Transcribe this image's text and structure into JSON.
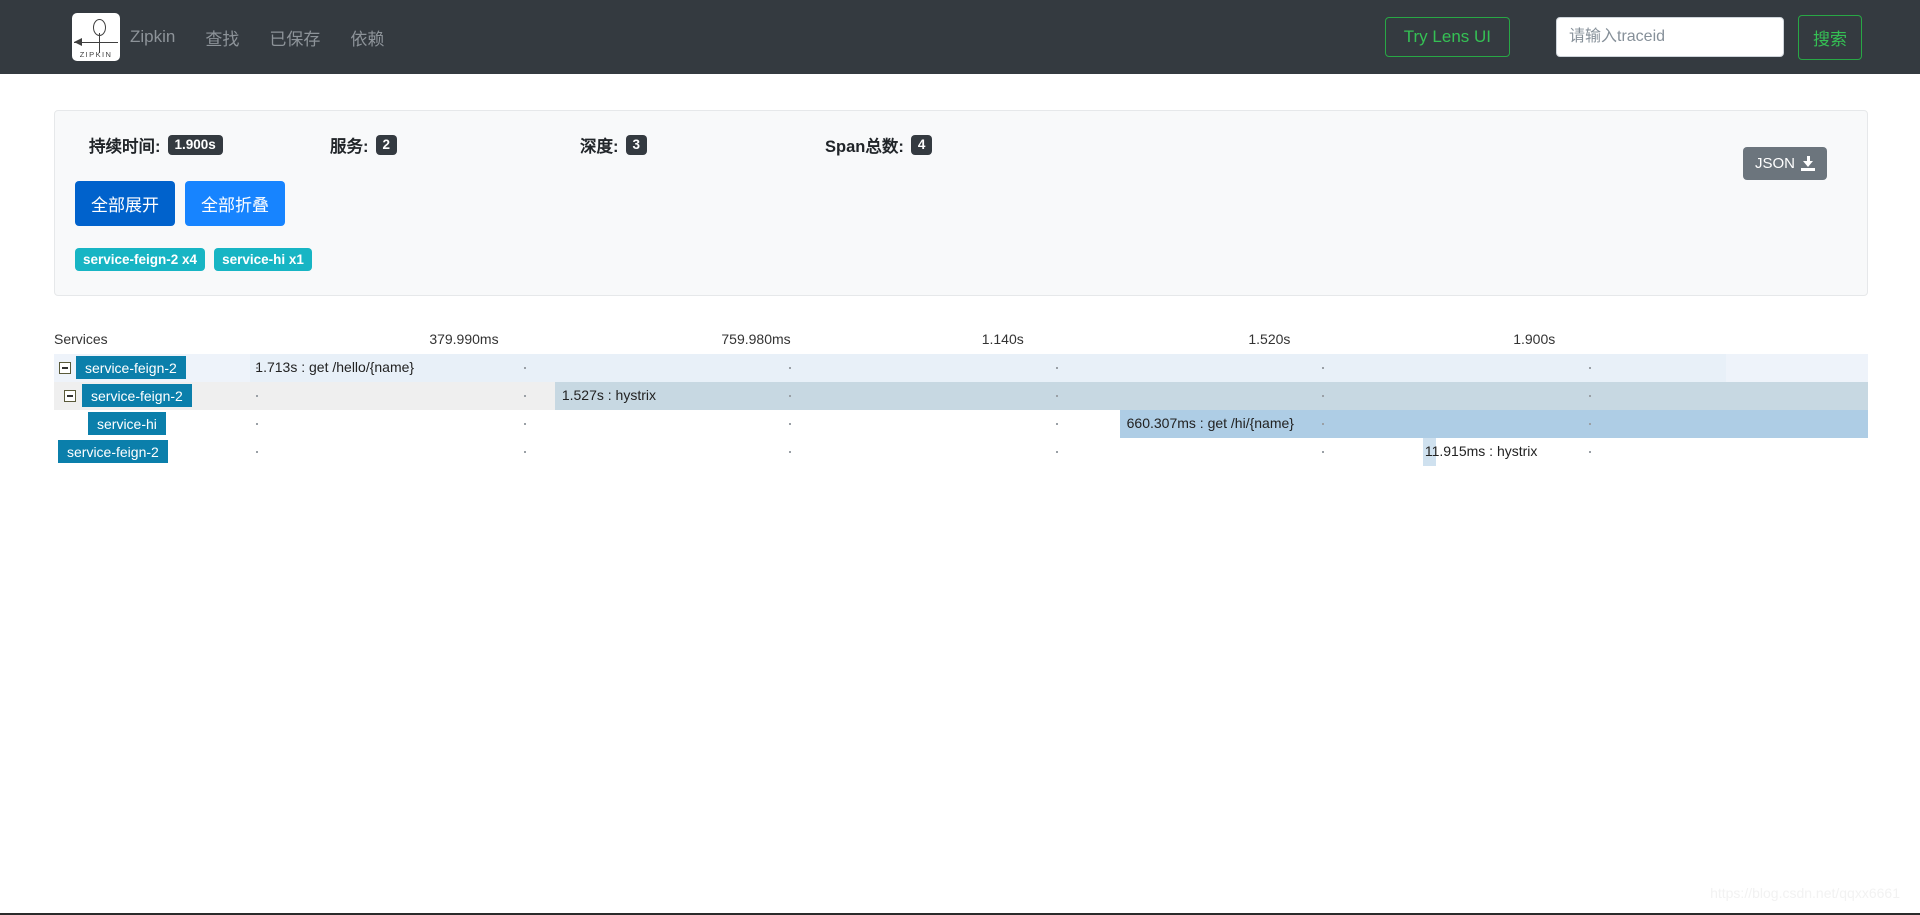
{
  "header": {
    "brand": "Zipkin",
    "logo_text": "ZIPKIN",
    "nav": [
      {
        "label": "查找"
      },
      {
        "label": "已保存"
      },
      {
        "label": "依赖"
      }
    ],
    "lens_button": "Try Lens UI",
    "search_placeholder": "请输入traceid",
    "search_value": "",
    "search_button": "搜索",
    "bg_color": "#343a40",
    "accent_green": "#28a745"
  },
  "summary": {
    "stats": [
      {
        "label": "持续时间:",
        "value": "1.900s"
      },
      {
        "label": "服务:",
        "value": "2"
      },
      {
        "label": "深度:",
        "value": "3"
      },
      {
        "label": "Span总数:",
        "value": "4"
      }
    ],
    "json_button": "JSON",
    "expand_all": "全部展开",
    "collapse_all": "全部折叠",
    "service_badges": [
      {
        "label": "service-feign-2 x4",
        "color": "#17b5c4"
      },
      {
        "label": "service-hi x1",
        "color": "#17b5c4"
      }
    ]
  },
  "timeline": {
    "services_header": "Services",
    "ticks": [
      {
        "label": "379.990ms",
        "pct": 22.6
      },
      {
        "label": "759.980ms",
        "pct": 38.7
      },
      {
        "label": "1.140s",
        "pct": 52.3
      },
      {
        "label": "1.520s",
        "pct": 67.0
      },
      {
        "label": "1.900s",
        "pct": 81.6
      }
    ],
    "dot_positions_pct": [
      3.3,
      19.4,
      35.3,
      51.3,
      67.3,
      83.3
    ],
    "bar_color": "#b3d1e8",
    "service_tag_color": "#0b7fab",
    "rows": [
      {
        "service": "service-feign-2",
        "depth": 0,
        "has_toggle": true,
        "label": "1.713s : get /hello/{name}",
        "bar_start_pct": 2.9,
        "bar_width_pct": 88.6,
        "bar_color": "#e8f0f8",
        "row_style": "hl"
      },
      {
        "service": "service-feign-2",
        "depth": 1,
        "has_toggle": true,
        "label": "1.527s : hystrix",
        "bar_start_pct": 21.2,
        "bar_width_pct": 78.8,
        "bar_color": "#c7d8e2",
        "row_style": "alt"
      },
      {
        "service": "service-hi",
        "depth": 2,
        "has_toggle": false,
        "label": "660.307ms : get /hi/{name}",
        "bar_start_pct": 55.1,
        "bar_width_pct": 44.9,
        "bar_color": "#aecde5",
        "row_style": "plain"
      },
      {
        "service": "service-feign-2",
        "depth": 1,
        "has_toggle": false,
        "label": "11.915ms : hystrix",
        "bar_start_pct": 73.3,
        "bar_width_pct": 0.75,
        "bar_color": "#cfe1ef",
        "row_style": "plain"
      }
    ]
  },
  "watermark": "https://blog.csdn.net/qqxx6661"
}
